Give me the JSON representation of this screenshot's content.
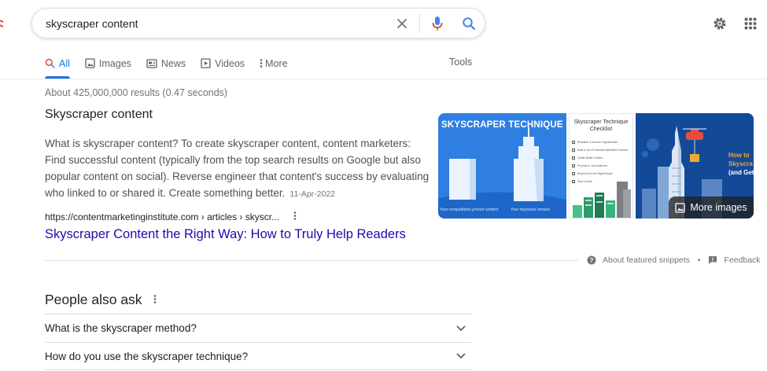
{
  "search": {
    "query": "skyscraper content",
    "clear_icon": "close-icon",
    "voice_icon": "microphone-icon",
    "search_icon": "search-icon"
  },
  "header": {
    "settings_icon": "gear-icon",
    "apps_icon": "apps-grid-icon"
  },
  "tabs": [
    {
      "label": "All",
      "icon": "search-icon",
      "active": true
    },
    {
      "label": "Images",
      "icon": "image-icon"
    },
    {
      "label": "News",
      "icon": "news-icon"
    },
    {
      "label": "Videos",
      "icon": "play-icon"
    },
    {
      "label": "More",
      "icon": "kebab-icon"
    }
  ],
  "tools_label": "Tools",
  "result_stats": "About 425,000,000 results (0.47 seconds)",
  "featured_snippet": {
    "title": "Skyscraper content",
    "text": "What is skyscraper content? To create skyscraper content, content marketers: Find successful content (typically from the top search results on Google but also popular content on social). Reverse engineer that content's success by evaluating who linked to or shared it. Create something better.",
    "date": "11-Apr-2022",
    "cite": "https://contentmarketinginstitute.com › articles › skyscr...",
    "link_title": "Skyscraper Content the Right Way: How to Truly Help Readers",
    "images": {
      "img1_title": "SKYSCRAPER TECHNIQUE",
      "img1_caption_left": "Your competitions proven content",
      "img1_caption_right": "Your improved version",
      "img2_title": "Skyscraper Technique Checklist",
      "img2_items": [
        "Research & Uncover Opportunities",
        "Build a List of Potential Distribution Partners",
        "Create Better Content",
        "Promote to Your Audience",
        "Reach Out to the Right People",
        "Stay Current"
      ],
      "img3_text_1": "How to",
      "img3_text_2": "Skyscra",
      "img3_text_3": "(and Get",
      "more_images": "More images"
    },
    "about_label": "About featured snippets",
    "separator": "•",
    "feedback_label": "Feedback"
  },
  "people_also_ask": {
    "title": "People also ask",
    "questions": [
      "What is the skyscraper method?",
      "How do you use the skyscraper technique?"
    ]
  },
  "colors": {
    "accent": "#1a73e8",
    "link": "#1a0dab",
    "text": "#202124",
    "muted": "#70757a"
  }
}
